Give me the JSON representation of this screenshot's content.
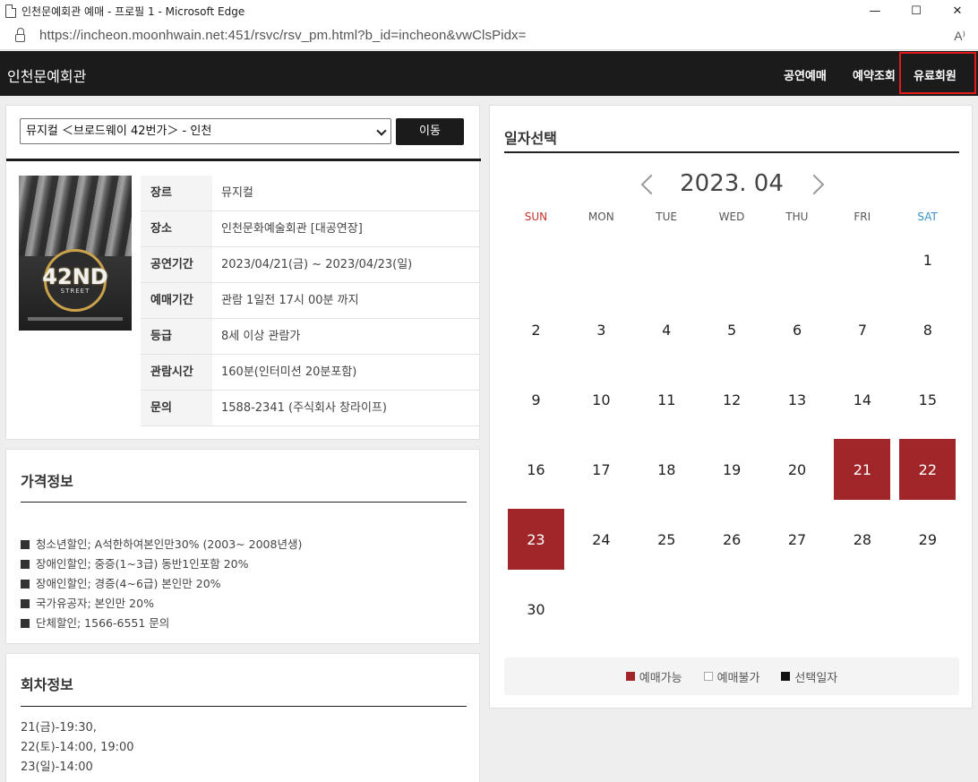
{
  "window": {
    "title": "인천문예회관 예매 - 프로필 1 - Microsoft Edge",
    "minimize": "—",
    "maximize": "☐",
    "close": "✕"
  },
  "address": {
    "url": "https://incheon.moonhwain.net:451/rsvc/rsv_pm.html?b_id=incheon&vwClsPidx=",
    "read_aloud": "A⁾"
  },
  "header": {
    "logo": "인천문예회관",
    "nav": [
      "공연예매",
      "예약조회",
      "유료회원"
    ]
  },
  "show": {
    "selected": "뮤지컬 ＜브로드웨이 42번가＞ - 인천",
    "move_button": "이동",
    "poster": {
      "main": "42ND",
      "sub": "STREET"
    },
    "info": [
      {
        "label": "장르",
        "value": "뮤지컬"
      },
      {
        "label": "장소",
        "value": "인천문화예술회관 [대공연장]"
      },
      {
        "label": "공연기간",
        "value": "2023/04/21(금) ~ 2023/04/23(일)"
      },
      {
        "label": "예매기간",
        "value": "관람 1일전 17시 00분 까지"
      },
      {
        "label": "등급",
        "value": "8세 이상 관람가"
      },
      {
        "label": "관람시간",
        "value": "160분(인터미션 20분포함)"
      },
      {
        "label": "문의",
        "value": "1588-2341 (주식회사 창라이프)"
      }
    ]
  },
  "price": {
    "title": "가격정보",
    "items": [
      "청소년할인; A석한하여본인만30% (2003~ 2008년생)",
      "장애인할인; 중증(1~3급) 동반1인포함 20%",
      "장애인할인; 경증(4~6급) 본인만 20%",
      "국가유공자; 본인만 20%",
      "단체할인; 1566-6551 문의"
    ]
  },
  "session": {
    "title": "회차정보",
    "items": [
      "21(금)-19:30,",
      "22(토)-14:00, 19:00",
      "23(일)-14:00"
    ]
  },
  "calendar": {
    "title": "일자선택",
    "month": "2023. 04",
    "weekdays": [
      "SUN",
      "MON",
      "TUE",
      "WED",
      "THU",
      "FRI",
      "SAT"
    ],
    "first_weekday": 6,
    "days_in_month": 30,
    "available_days": [
      21,
      22,
      23
    ],
    "legend": [
      "예매가능",
      "예매불가",
      "선택일자"
    ]
  },
  "colors": {
    "header_bg": "#1b1b1b",
    "available": "#a1262a",
    "sunday": "#c8322d",
    "saturday": "#3a8fc6",
    "highlight_border": "#e01b1b"
  }
}
